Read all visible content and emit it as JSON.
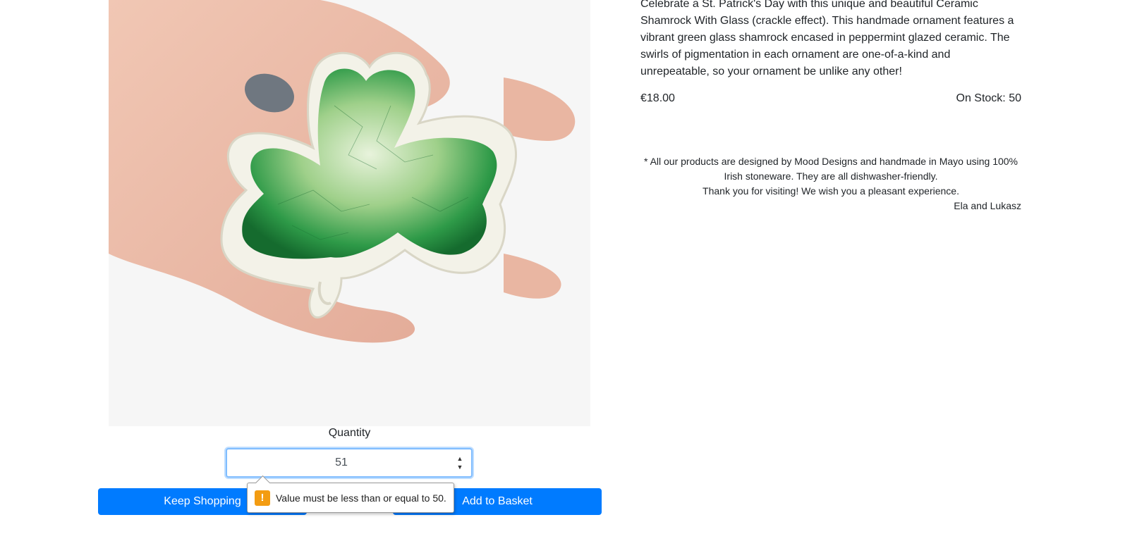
{
  "product": {
    "description": "Celebrate a St. Patrick's Day with this unique and beautiful Ceramic Shamrock With Glass (crackle effect). This handmade ornament features a vibrant green glass shamrock encased in peppermint glazed ceramic. The swirls of pigmentation in each ornament are one-of-a-kind and unrepeatable, so your ornament be unlike any other!",
    "price": "€18.00",
    "stock": "On Stock: 50"
  },
  "note": {
    "line1": "* All our products are designed by Mood Designs and handmade in Mayo using 100% Irish stoneware. They are all dishwasher-friendly.",
    "line2": "Thank you for visiting! We wish you a pleasant experience.",
    "signature": "Ela and Lukasz"
  },
  "quantity": {
    "label": "Quantity",
    "value": "51"
  },
  "buttons": {
    "keep_shopping": "Keep Shopping",
    "add_to_basket": "Add to Basket"
  },
  "validation": {
    "message": "Value must be less than or equal to 50.",
    "icon_glyph": "!"
  },
  "colors": {
    "primary": "#007bff",
    "warning": "#f39c12",
    "focus_border": "#80bdff"
  }
}
